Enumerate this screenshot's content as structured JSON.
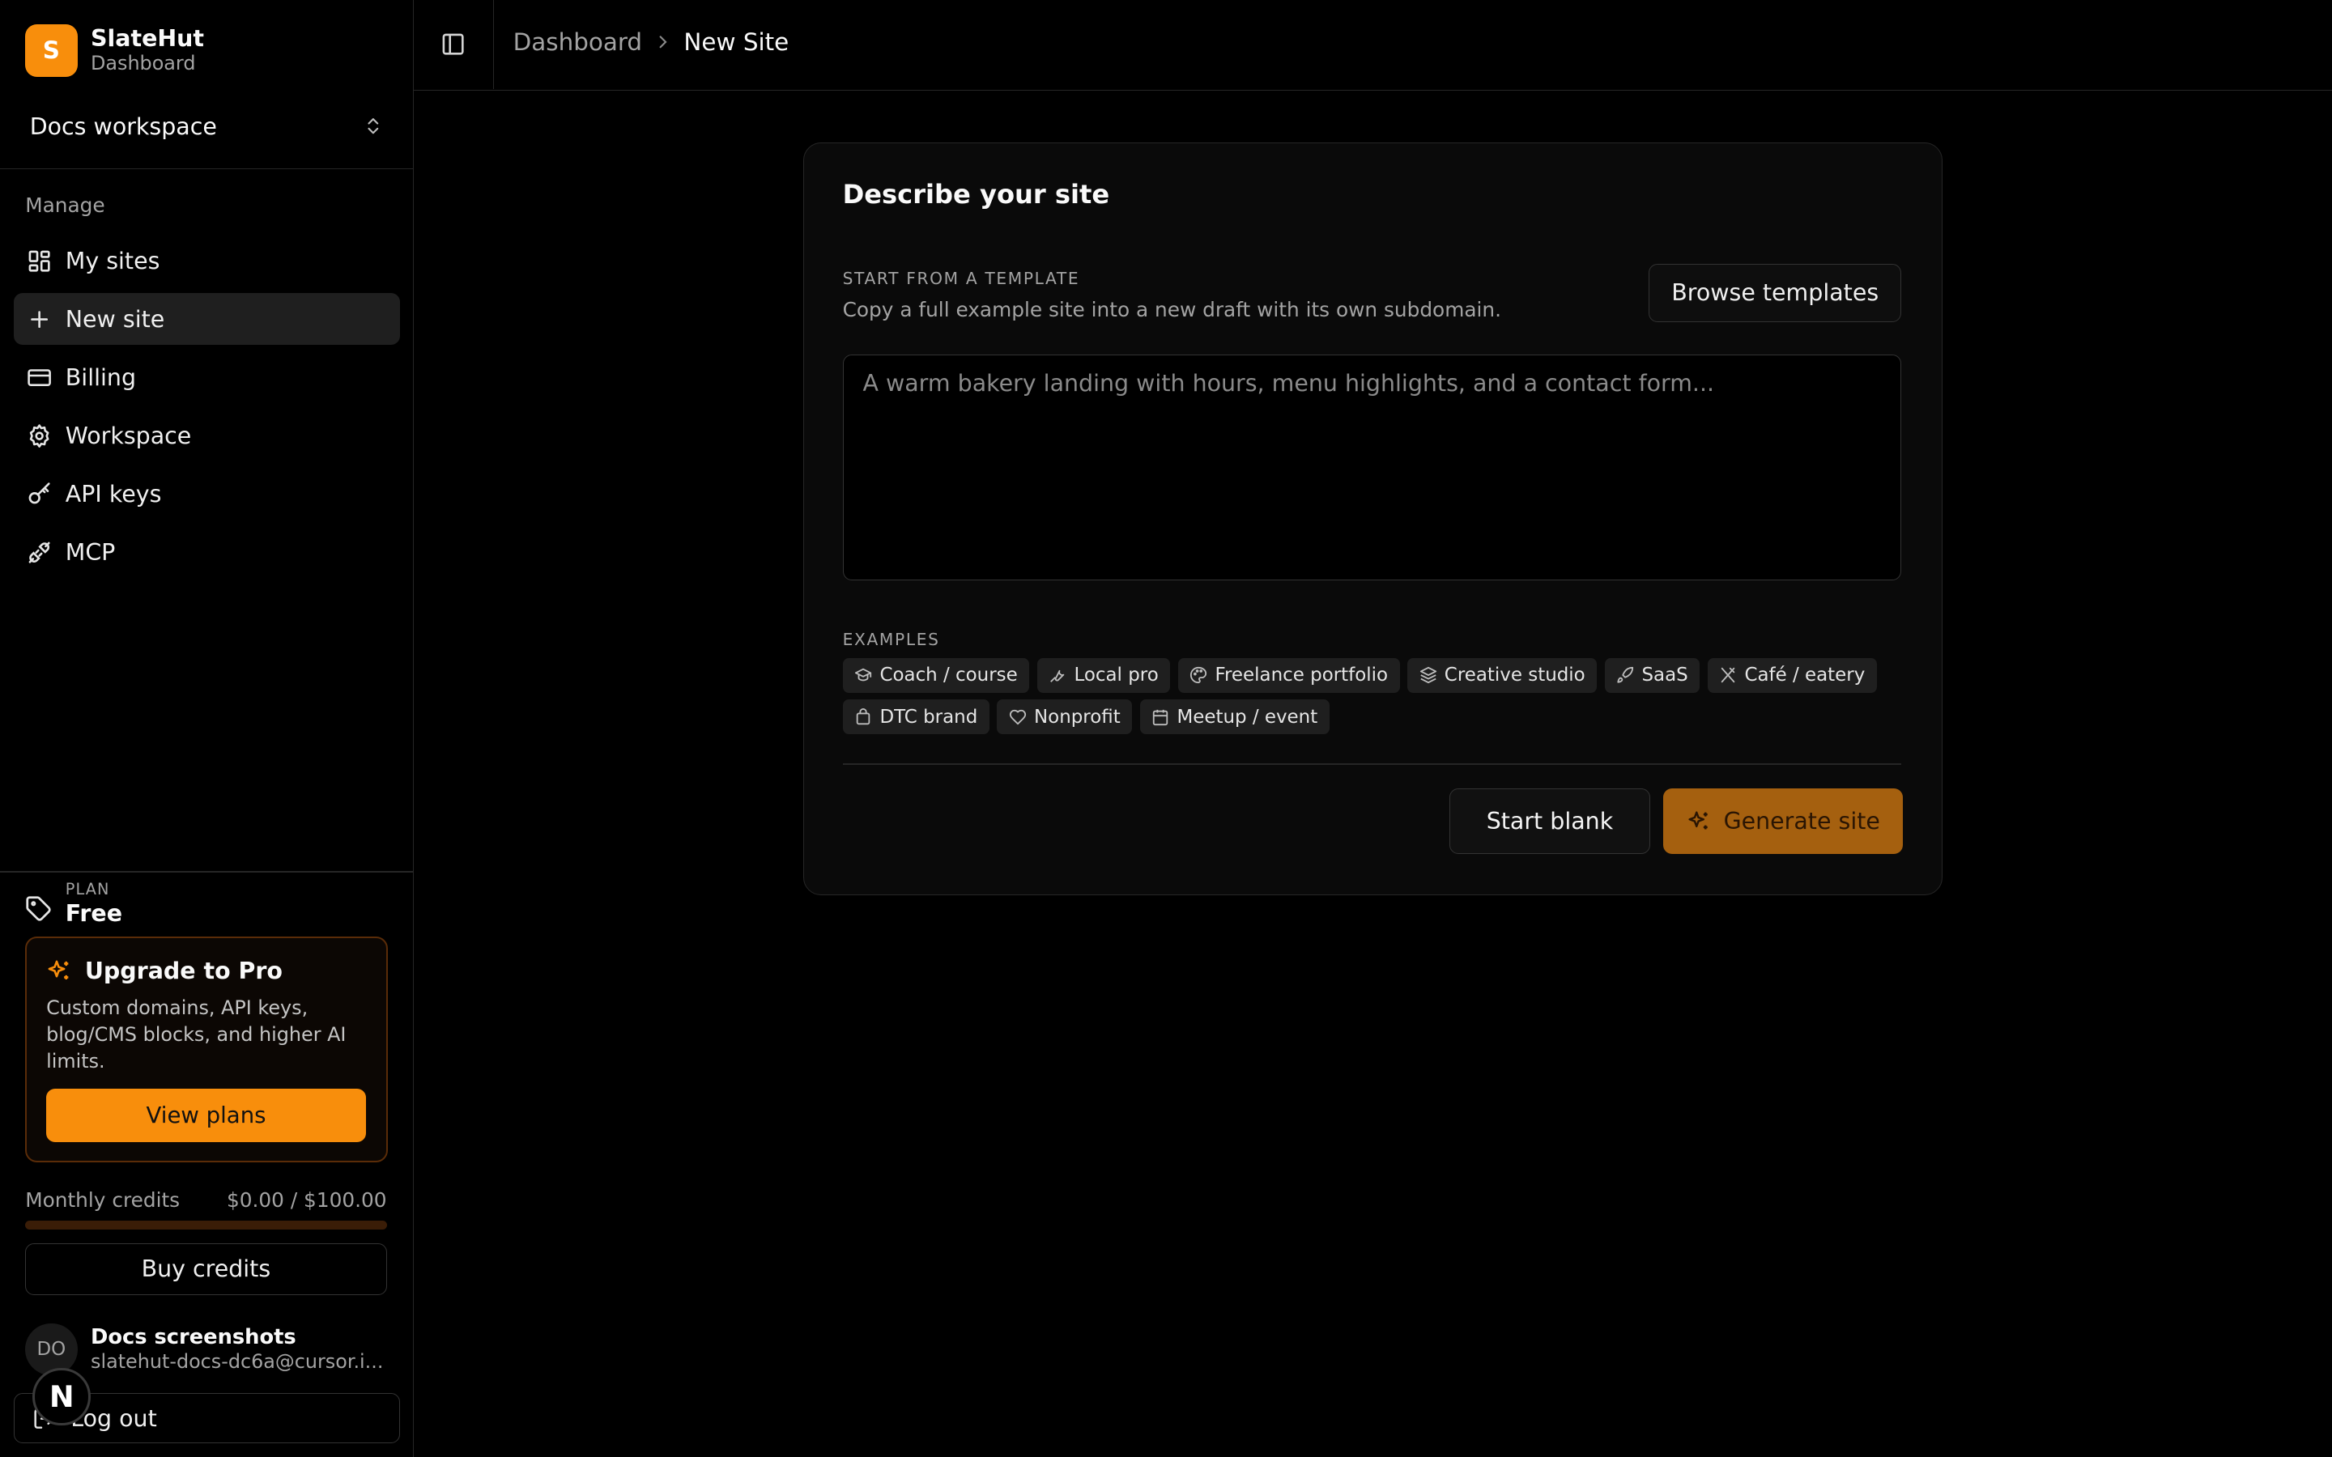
{
  "brand": {
    "logo_letter": "S",
    "name": "SlateHut",
    "subtitle": "Dashboard",
    "accent_color": "#f88e0c"
  },
  "workspace": {
    "label": "Docs workspace"
  },
  "sidebar": {
    "group_label": "Manage",
    "items": [
      {
        "label": "My sites",
        "icon": "grid-icon"
      },
      {
        "label": "New site",
        "icon": "plus-icon",
        "active": true
      },
      {
        "label": "Billing",
        "icon": "credit-card-icon"
      },
      {
        "label": "Workspace",
        "icon": "gear-icon"
      },
      {
        "label": "API keys",
        "icon": "key-icon"
      },
      {
        "label": "MCP",
        "icon": "plug-icon"
      }
    ]
  },
  "plan": {
    "label": "PLAN",
    "name": "Free"
  },
  "upgrade": {
    "title": "Upgrade to Pro",
    "description": "Custom domains, API keys, blog/CMS blocks, and higher AI limits.",
    "button": "View plans"
  },
  "credits": {
    "label": "Monthly credits",
    "value": "$0.00 / $100.00",
    "used_fraction": 0.0
  },
  "buy_credits": "Buy credits",
  "user": {
    "initials": "DO",
    "name": "Docs screenshots",
    "email": "slatehut-docs-dc6a@cursor.i..."
  },
  "logout": "Log out",
  "overlay_badge": "N",
  "breadcrumb": {
    "parent": "Dashboard",
    "current": "New Site"
  },
  "card": {
    "title": "Describe your site",
    "template_label": "START FROM A TEMPLATE",
    "template_desc": "Copy a full example site into a new draft with its own subdomain.",
    "browse_button": "Browse templates",
    "prompt_value": "",
    "prompt_placeholder": "A warm bakery landing with hours, menu highlights, and a contact form...",
    "examples_label": "EXAMPLES",
    "examples": [
      {
        "label": "Coach / course",
        "icon": "graduation-cap-icon"
      },
      {
        "label": "Local pro",
        "icon": "wrench-icon"
      },
      {
        "label": "Freelance portfolio",
        "icon": "palette-icon"
      },
      {
        "label": "Creative studio",
        "icon": "layers-icon"
      },
      {
        "label": "SaaS",
        "icon": "rocket-icon"
      },
      {
        "label": "Café / eatery",
        "icon": "utensils-icon"
      },
      {
        "label": "DTC brand",
        "icon": "shopping-bag-icon"
      },
      {
        "label": "Nonprofit",
        "icon": "heart-handshake-icon"
      },
      {
        "label": "Meetup / event",
        "icon": "calendar-icon"
      }
    ],
    "start_blank": "Start blank",
    "generate": "Generate site"
  }
}
